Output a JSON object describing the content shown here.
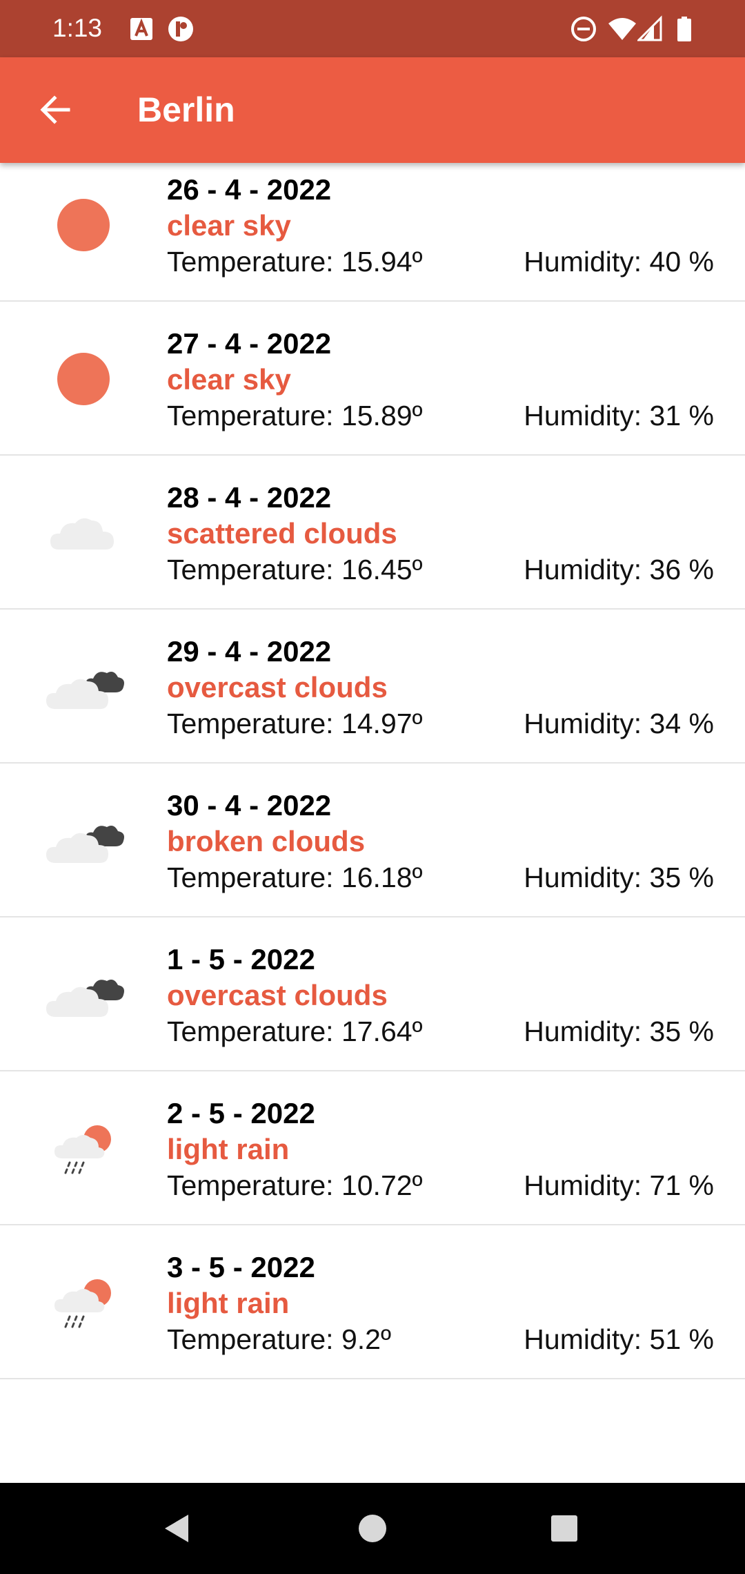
{
  "status_bar": {
    "time": "1:13",
    "icons": [
      "accessibility-icon",
      "app-notification-icon",
      "do-not-disturb-icon",
      "wifi-icon",
      "cellular-signal-icon",
      "battery-icon"
    ]
  },
  "app_bar": {
    "back_icon": "arrow-back-icon",
    "title": "Berlin"
  },
  "colors": {
    "status_bar": "#ac4230",
    "app_bar": "#ec5c43",
    "accent_text": "#e65a40",
    "sun": "#ee7458"
  },
  "forecast": [
    {
      "date": "26 - 4 - 2022",
      "description": "clear sky",
      "temperature": "Temperature: 15.94º",
      "humidity": "Humidity: 40 %",
      "icon": "clear-sky-icon"
    },
    {
      "date": "27 - 4 - 2022",
      "description": "clear sky",
      "temperature": "Temperature: 15.89º",
      "humidity": "Humidity: 31 %",
      "icon": "clear-sky-icon"
    },
    {
      "date": "28 - 4 - 2022",
      "description": "scattered clouds",
      "temperature": "Temperature: 16.45º",
      "humidity": "Humidity: 36 %",
      "icon": "scattered-clouds-icon"
    },
    {
      "date": "29 - 4 - 2022",
      "description": "overcast clouds",
      "temperature": "Temperature: 14.97º",
      "humidity": "Humidity: 34 %",
      "icon": "overcast-clouds-icon"
    },
    {
      "date": "30 - 4 - 2022",
      "description": "broken clouds",
      "temperature": "Temperature: 16.18º",
      "humidity": "Humidity: 35 %",
      "icon": "broken-clouds-icon"
    },
    {
      "date": "1 - 5 - 2022",
      "description": "overcast clouds",
      "temperature": "Temperature: 17.64º",
      "humidity": "Humidity: 35 %",
      "icon": "overcast-clouds-icon"
    },
    {
      "date": "2 - 5 - 2022",
      "description": "light rain",
      "temperature": "Temperature: 10.72º",
      "humidity": "Humidity: 71 %",
      "icon": "light-rain-icon"
    },
    {
      "date": "3 - 5 - 2022",
      "description": "light rain",
      "temperature": "Temperature: 9.2º",
      "humidity": "Humidity: 51 %",
      "icon": "light-rain-icon"
    }
  ],
  "nav_bar": {
    "icons": [
      "nav-back-icon",
      "nav-home-icon",
      "nav-recents-icon"
    ]
  }
}
